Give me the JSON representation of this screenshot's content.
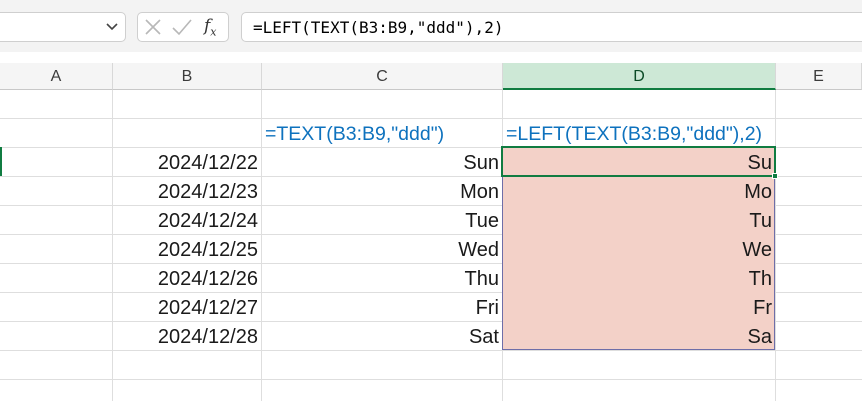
{
  "formula_bar": {
    "name_box_value": "",
    "formula": "=LEFT(TEXT(B3:B9,\"ddd\"),2)"
  },
  "columns": [
    "A",
    "B",
    "C",
    "D",
    "E"
  ],
  "selected_column": "D",
  "headers_row": {
    "C": "=TEXT(B3:B9,\"ddd\")",
    "D": "=LEFT(TEXT(B3:B9,\"ddd\"),2)"
  },
  "rows": [
    {
      "date": "2024/12/22",
      "day": "Sun",
      "abbr": "Su"
    },
    {
      "date": "2024/12/23",
      "day": "Mon",
      "abbr": "Mo"
    },
    {
      "date": "2024/12/24",
      "day": "Tue",
      "abbr": "Tu"
    },
    {
      "date": "2024/12/25",
      "day": "Wed",
      "abbr": "We"
    },
    {
      "date": "2024/12/26",
      "day": "Thu",
      "abbr": "Th"
    },
    {
      "date": "2024/12/27",
      "day": "Fri",
      "abbr": "Fr"
    },
    {
      "date": "2024/12/28",
      "day": "Sat",
      "abbr": "Sa"
    }
  ],
  "colors": {
    "accent": "#107c41",
    "formula_text": "#0e72be",
    "spill_fill": "#f3d1c8"
  }
}
